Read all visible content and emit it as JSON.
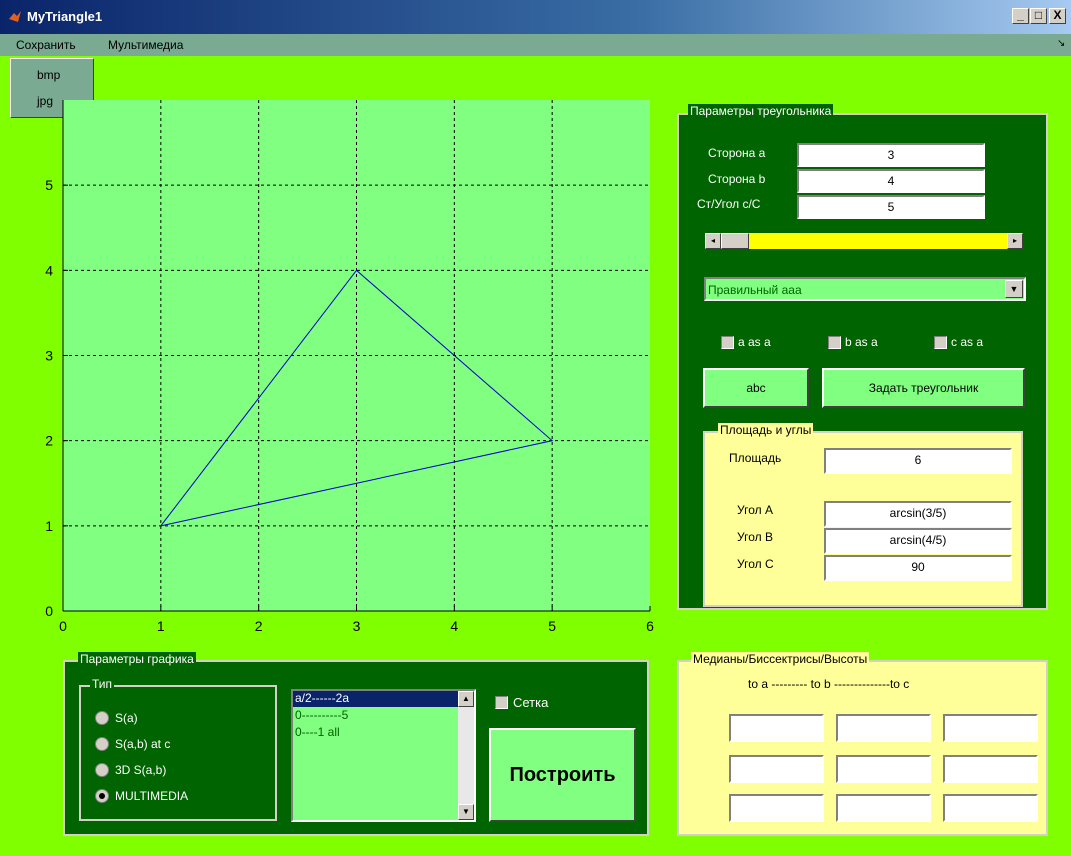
{
  "window": {
    "title": "MyTriangle1",
    "minimize": "_",
    "maximize": "□",
    "close": "X"
  },
  "menu": {
    "save": "Сохранить",
    "multimedia": "Мультимедиа",
    "dropdown": [
      "bmp",
      "jpg"
    ],
    "corner": "↘"
  },
  "plot": {
    "x_ticks": [
      "0",
      "1",
      "2",
      "3",
      "4",
      "5",
      "6"
    ],
    "y_ticks": [
      "0",
      "1",
      "2",
      "3",
      "4",
      "5"
    ],
    "xlim": [
      0,
      6
    ],
    "ylim": [
      0,
      6
    ],
    "grid": true,
    "line_color": "#0000cc",
    "background": "#80ff80"
  },
  "chart_data": {
    "type": "line",
    "x": [
      1,
      3,
      5,
      1
    ],
    "y": [
      1,
      4,
      2,
      1
    ],
    "xlim": [
      0,
      6
    ],
    "ylim": [
      0,
      6
    ],
    "grid": true
  },
  "triangle_params": {
    "title": "Параметры треугольника",
    "side_a_label": "Сторона a",
    "side_a": "3",
    "side_b_label": "Сторона b",
    "side_b": "4",
    "side_c_label": "Ст/Угол  c/C",
    "side_c": "5",
    "type_select": "Правильный aaa",
    "cb_a": "a as a",
    "cb_b": "b as a",
    "cb_c": "c as a",
    "abc_button": "abc",
    "set_button": "Задать треугольник"
  },
  "area_angles": {
    "title": "Площадь и углы",
    "area_label": "Площадь",
    "area": "6",
    "angle_a_label": "Угол A",
    "angle_a": "arcsin(3/5)",
    "angle_b_label": "Угол B",
    "angle_b": "arcsin(4/5)",
    "angle_c_label": "Угол C",
    "angle_c": "90"
  },
  "graph_params": {
    "title": "Параметры графика",
    "type_title": "Тип",
    "radios": [
      "S(a)",
      "S(a,b) at c",
      "3D S(a,b)",
      "MULTIMEDIA"
    ],
    "selected_radio": 3,
    "listbox": [
      "a/2------2a",
      "0----------5",
      "0----1   all"
    ],
    "grid_label": "Сетка",
    "build_button": "Построить"
  },
  "medians": {
    "title": "Медианы/Биссектрисы/Высоты",
    "header": "to a --------- to b --------------to c"
  },
  "colors": {
    "slider_track": "#ffff00",
    "panel": "#006400",
    "accent": "#80ff00"
  }
}
